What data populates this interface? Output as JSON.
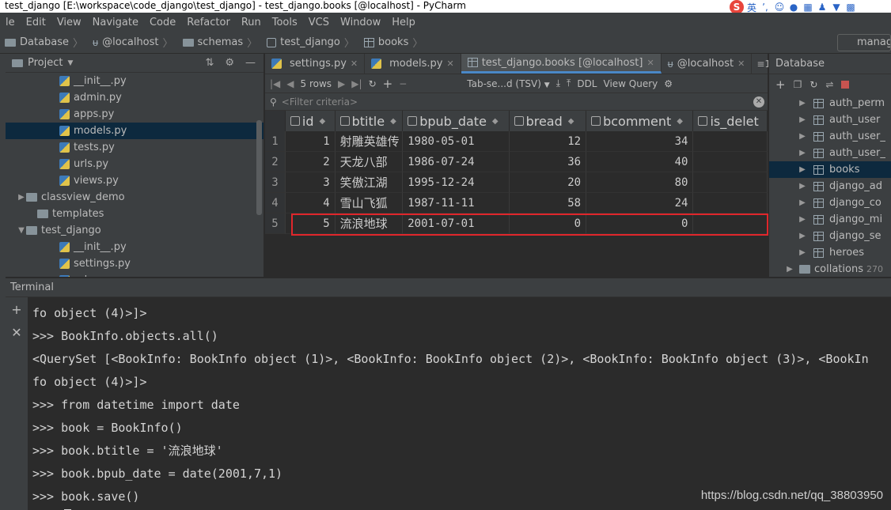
{
  "window": {
    "title": "test_django [E:\\workspace\\code_django\\test_django] - test_django.books [@localhost] - PyCharm"
  },
  "ime": {
    "logo": "S",
    "mode": "英",
    "icons": [
      "comma-icon",
      "smile-icon",
      "mic-icon",
      "keyboard-icon",
      "user-icon",
      "shirt-icon",
      "grid-icon"
    ]
  },
  "menu": [
    "le",
    "Edit",
    "View",
    "Navigate",
    "Code",
    "Refactor",
    "Run",
    "Tools",
    "VCS",
    "Window",
    "Help"
  ],
  "breadcrumb": [
    "Database",
    "@localhost",
    "schemas",
    "test_django",
    "books"
  ],
  "manage_label": "manag",
  "project": {
    "header": "Project",
    "items": [
      {
        "label": "__init__.py",
        "indent": 4,
        "type": "py"
      },
      {
        "label": "admin.py",
        "indent": 4,
        "type": "py"
      },
      {
        "label": "apps.py",
        "indent": 4,
        "type": "py"
      },
      {
        "label": "models.py",
        "indent": 4,
        "type": "py",
        "selected": true
      },
      {
        "label": "tests.py",
        "indent": 4,
        "type": "py"
      },
      {
        "label": "urls.py",
        "indent": 4,
        "type": "py"
      },
      {
        "label": "views.py",
        "indent": 4,
        "type": "py"
      },
      {
        "label": "classview_demo",
        "indent": 1,
        "type": "folder",
        "arrow": "▶"
      },
      {
        "label": "templates",
        "indent": 2,
        "type": "folder"
      },
      {
        "label": "test_django",
        "indent": 1,
        "type": "folder",
        "arrow": "▼"
      },
      {
        "label": "__init__.py",
        "indent": 4,
        "type": "py"
      },
      {
        "label": "settings.py",
        "indent": 4,
        "type": "py"
      },
      {
        "label": "urls.py",
        "indent": 4,
        "type": "py"
      }
    ]
  },
  "tabs": [
    {
      "label": "settings.py",
      "active": false
    },
    {
      "label": "models.py",
      "active": false
    },
    {
      "label": "test_django.books [@localhost]",
      "active": true
    },
    {
      "label": "@localhost",
      "active": false
    }
  ],
  "tab_more": "≡1",
  "toolbar": {
    "rows": "5 rows",
    "format": "Tab-se...d (TSV)",
    "ddl": "DDL",
    "view_query": "View Query"
  },
  "filter_placeholder": "<Filter criteria>",
  "grid": {
    "columns": [
      "id",
      "btitle",
      "bpub_date",
      "bread",
      "bcomment",
      "is_delet"
    ],
    "rows": [
      [
        "1",
        "1",
        "射雕英雄传",
        "1980-05-01",
        "12",
        "34",
        ""
      ],
      [
        "2",
        "2",
        "天龙八部",
        "1986-07-24",
        "36",
        "40",
        ""
      ],
      [
        "3",
        "3",
        "笑傲江湖",
        "1995-12-24",
        "20",
        "80",
        ""
      ],
      [
        "4",
        "4",
        "雪山飞狐",
        "1987-11-11",
        "58",
        "24",
        ""
      ],
      [
        "5",
        "5",
        "流浪地球",
        "2001-07-01",
        "0",
        "0",
        ""
      ]
    ]
  },
  "database": {
    "header": "Database",
    "items": [
      {
        "label": "auth_perm",
        "selected": false
      },
      {
        "label": "auth_user",
        "selected": false
      },
      {
        "label": "auth_user_",
        "selected": false
      },
      {
        "label": "auth_user_",
        "selected": false
      },
      {
        "label": "books",
        "selected": true
      },
      {
        "label": "django_ad",
        "selected": false
      },
      {
        "label": "django_co",
        "selected": false
      },
      {
        "label": "django_mi",
        "selected": false
      },
      {
        "label": "django_se",
        "selected": false
      },
      {
        "label": "heroes",
        "selected": false
      }
    ],
    "collations": {
      "label": "collations",
      "count": "270"
    }
  },
  "terminal": {
    "header": "Terminal",
    "lines": [
      "fo object (4)>]>",
      ">>> BookInfo.objects.all()",
      "<QuerySet [<BookInfo: BookInfo object (1)>, <BookInfo: BookInfo object (2)>, <BookInfo: BookInfo object (3)>, <BookIn",
      "fo object (4)>]>",
      ">>> from datetime import date",
      ">>> book = BookInfo()",
      ">>> book.btitle = '流浪地球'",
      ">>> book.bpub_date = date(2001,7,1)",
      ">>> book.save()"
    ]
  },
  "watermark": "https://blog.csdn.net/qq_38803950",
  "colors": {
    "selection": "#0d293e",
    "highlight_box": "#e0262b",
    "active_tab_underline": "#4a88c7"
  }
}
